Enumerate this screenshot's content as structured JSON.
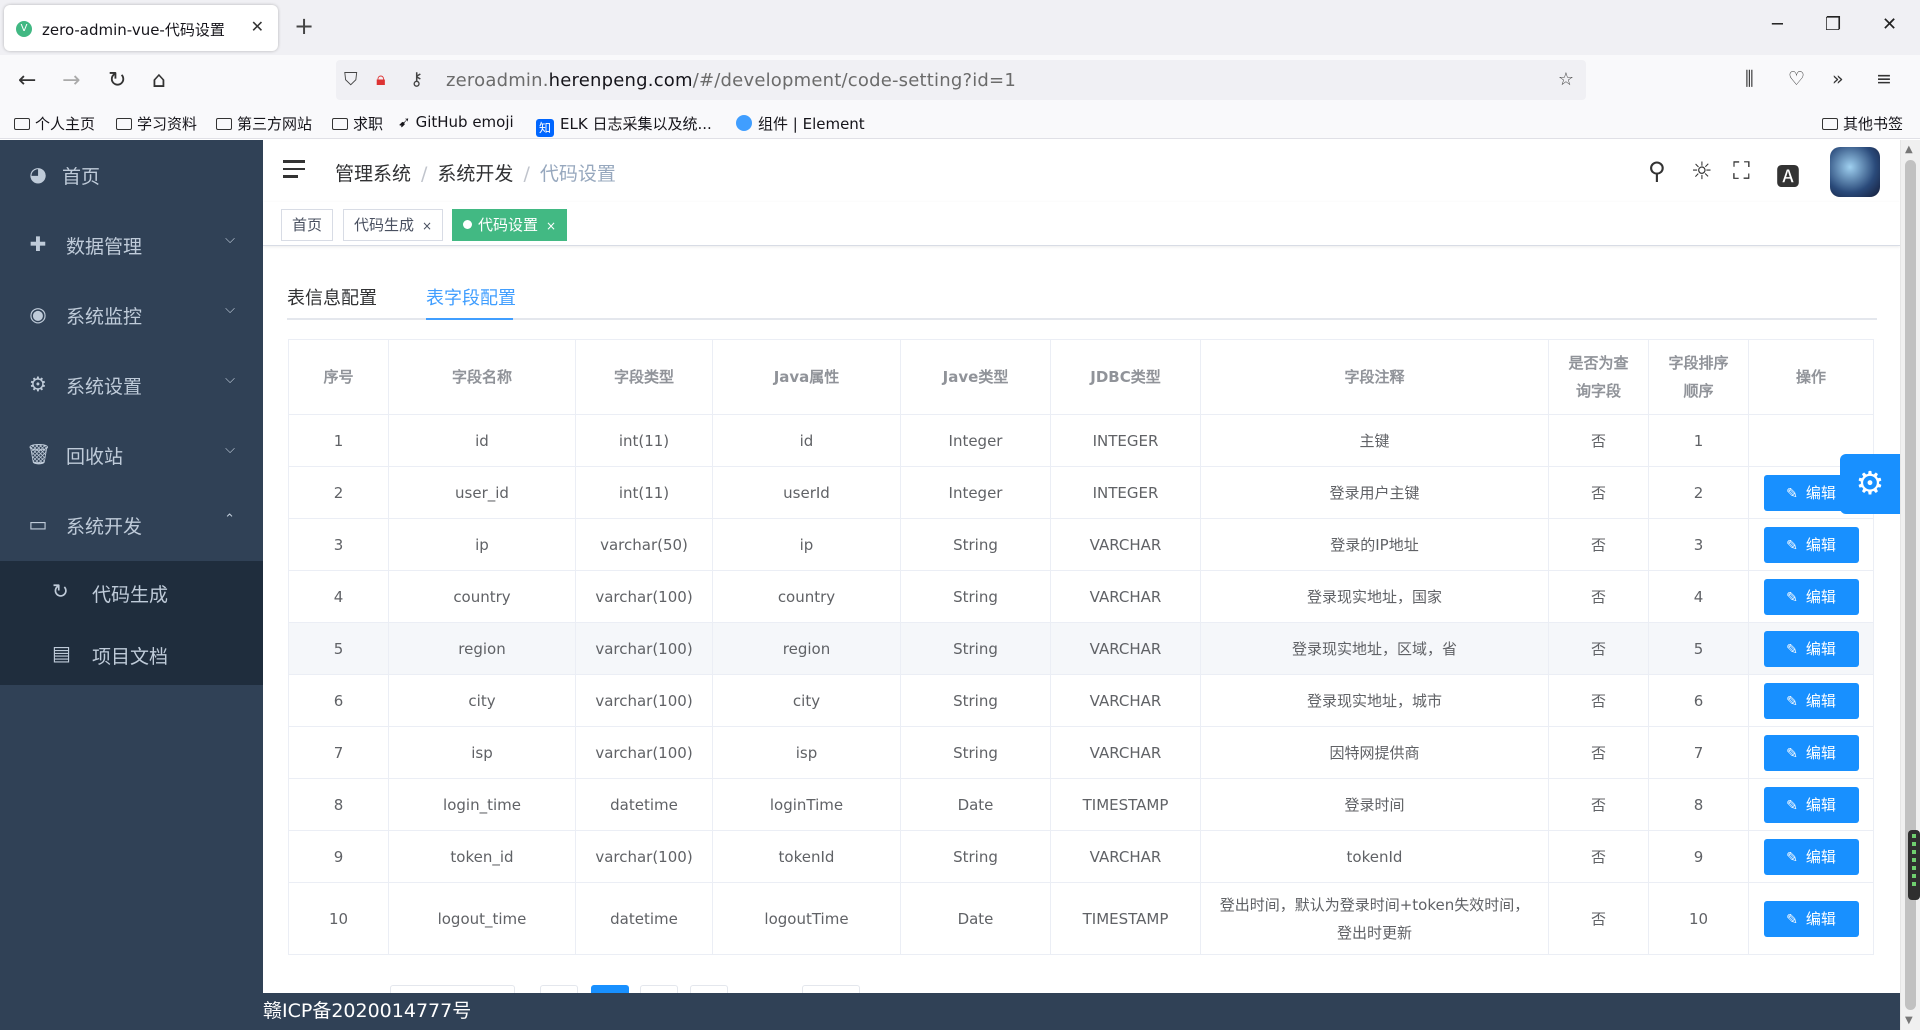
{
  "browser": {
    "tab_title": "zero-admin-vue-代码设置",
    "new_tab": "+",
    "url_host_pre": "zeroadmin.",
    "url_host": "herenpeng.com",
    "url_path": "/#/development/code-setting?id=1"
  },
  "bookmarks": [
    {
      "label": "个人主页",
      "icon": "folder-icon"
    },
    {
      "label": "学习资料",
      "icon": "folder-icon"
    },
    {
      "label": "第三方网站",
      "icon": "folder-icon"
    },
    {
      "label": "求职",
      "icon": "folder-icon"
    },
    {
      "label": "GitHub emoji",
      "icon": "github-icon"
    },
    {
      "label": "ELK 日志采集以及统...",
      "icon": "zhihu-icon"
    },
    {
      "label": "组件 | Element",
      "icon": "element-icon"
    },
    {
      "label": "其他书签",
      "icon": "folder-icon"
    }
  ],
  "sidebar": {
    "items": [
      {
        "label": "首页",
        "icon": "dashboard-icon"
      },
      {
        "label": "数据管理",
        "icon": "data-icon"
      },
      {
        "label": "系统监控",
        "icon": "eye-icon"
      },
      {
        "label": "系统设置",
        "icon": "gear-icon"
      },
      {
        "label": "回收站",
        "icon": "trash-icon"
      },
      {
        "label": "系统开发",
        "icon": "monitor-icon"
      }
    ],
    "subitems": [
      {
        "label": "代码生成",
        "icon": "refresh-icon"
      },
      {
        "label": "项目文档",
        "icon": "document-icon"
      }
    ]
  },
  "breadcrumb": [
    "管理系统",
    "系统开发",
    "代码设置"
  ],
  "tags": [
    {
      "label": "首页"
    },
    {
      "label": "代码生成"
    },
    {
      "label": "代码设置"
    }
  ],
  "tabs": [
    "表信息配置",
    "表字段配置"
  ],
  "table": {
    "headers": [
      "序号",
      "字段名称",
      "字段类型",
      "Java属性",
      "Jave类型",
      "JDBC类型",
      "字段注释",
      "是否为查\n询字段",
      "字段排序\n顺序",
      "操作"
    ],
    "header_query_1": "是否为查",
    "header_query_2": "询字段",
    "header_sort_1": "字段排序",
    "header_sort_2": "顺序",
    "edit_label": "编辑",
    "rows": [
      [
        "1",
        "id",
        "int(11)",
        "id",
        "Integer",
        "INTEGER",
        "主键",
        "否",
        "1"
      ],
      [
        "2",
        "user_id",
        "int(11)",
        "userId",
        "Integer",
        "INTEGER",
        "登录用户主键",
        "否",
        "2"
      ],
      [
        "3",
        "ip",
        "varchar(50)",
        "ip",
        "String",
        "VARCHAR",
        "登录的IP地址",
        "否",
        "3"
      ],
      [
        "4",
        "country",
        "varchar(100)",
        "country",
        "String",
        "VARCHAR",
        "登录现实地址，国家",
        "否",
        "4"
      ],
      [
        "5",
        "region",
        "varchar(100)",
        "region",
        "String",
        "VARCHAR",
        "登录现实地址，区域，省",
        "否",
        "5"
      ],
      [
        "6",
        "city",
        "varchar(100)",
        "city",
        "String",
        "VARCHAR",
        "登录现实地址，城市",
        "否",
        "6"
      ],
      [
        "7",
        "isp",
        "varchar(100)",
        "isp",
        "String",
        "VARCHAR",
        "因特网提供商",
        "否",
        "7"
      ],
      [
        "8",
        "login_time",
        "datetime",
        "loginTime",
        "Date",
        "TIMESTAMP",
        "登录时间",
        "否",
        "8"
      ],
      [
        "9",
        "token_id",
        "varchar(100)",
        "tokenId",
        "String",
        "VARCHAR",
        "tokenId",
        "否",
        "9"
      ],
      [
        "10",
        "logout_time",
        "datetime",
        "logoutTime",
        "Date",
        "TIMESTAMP",
        "登出时间，默认为登录时间+token失效时间，登出时更新",
        "否",
        "10"
      ]
    ]
  },
  "footer": "赣ICP备2020014777号",
  "colors": {
    "primary": "#1890ff",
    "sidebar": "#304156",
    "tag_active": "#42b983"
  }
}
